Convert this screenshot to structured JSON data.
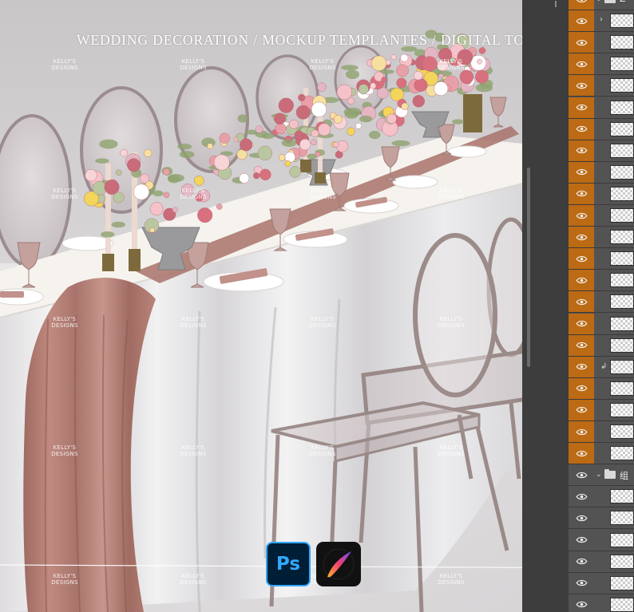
{
  "banner": {
    "title": "WEDDING DECORATION  /  MOCKUP TEMPLANTES / DIGITAL TOOLKIT"
  },
  "watermark": {
    "line1": "KELLY'S",
    "line2": "DESIGNS"
  },
  "layers_panel": {
    "group_top_label": "Z",
    "group_bottom_label": "组",
    "visibility_icon": "eye-icon",
    "folder_icon": "folder-icon"
  },
  "app_badges": {
    "photoshop_label": "Ps",
    "procreate_icon": "procreate-brush-icon"
  },
  "colors": {
    "ps_panel": "#535353",
    "ps_panel_dark": "#3d3d3d",
    "highlight_orange": "#bc6a13",
    "linen": "#f6f3ee",
    "runner": "#b07a70",
    "photoshop_blue": "#31a8ff"
  }
}
